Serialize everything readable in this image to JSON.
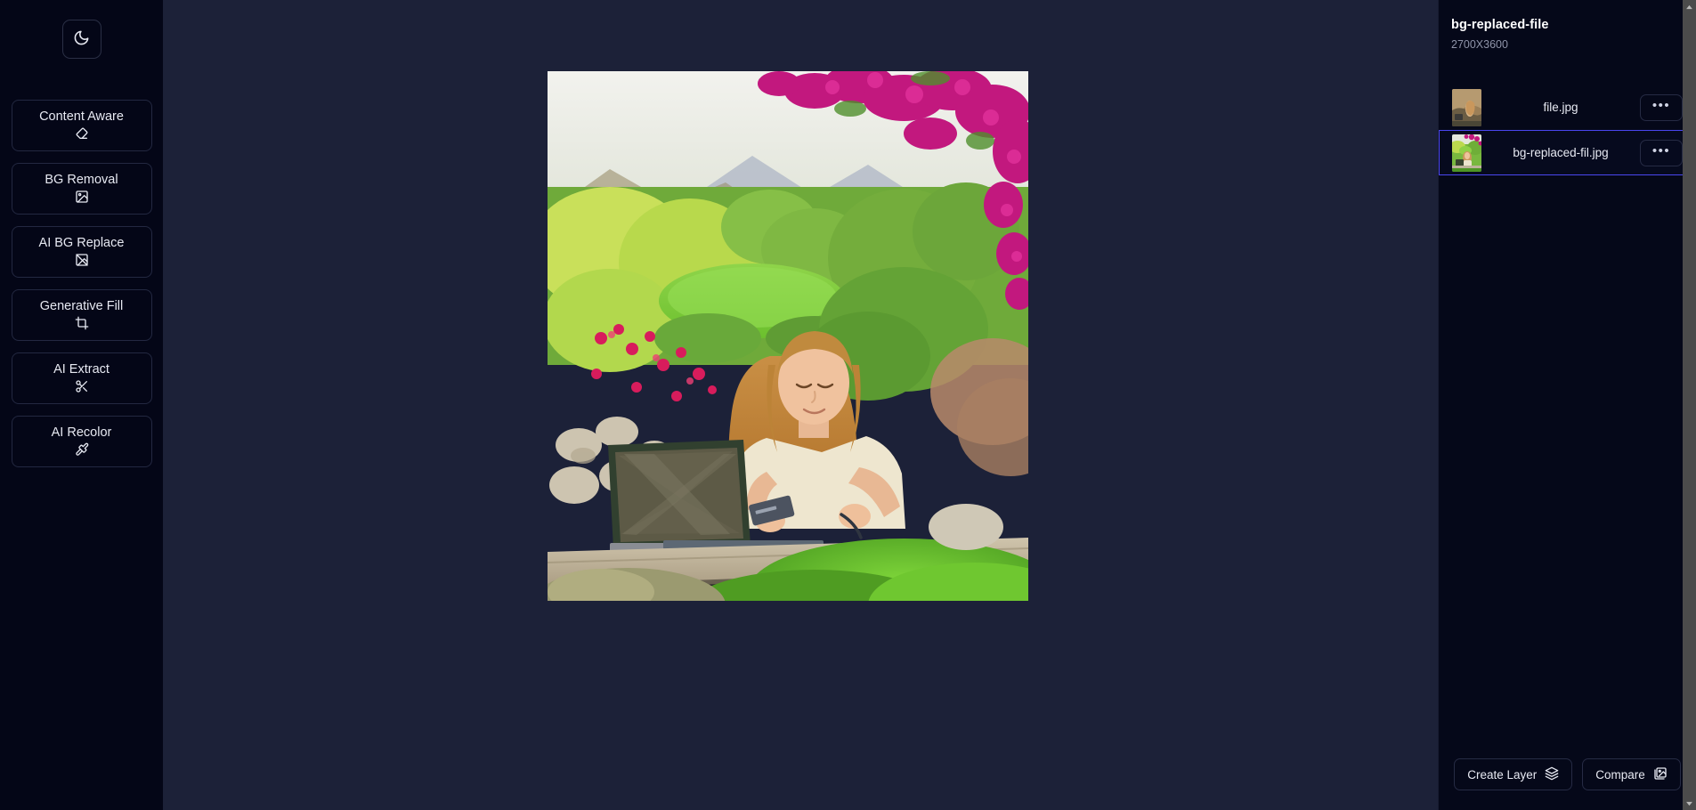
{
  "theme_toggle": {
    "icon": "moon-icon",
    "label": "Toggle dark mode"
  },
  "sidebar": {
    "tools": [
      {
        "label": "Content Aware",
        "icon": "eraser-icon"
      },
      {
        "label": "BG Removal",
        "icon": "image-icon"
      },
      {
        "label": "AI BG Replace",
        "icon": "image-off-icon"
      },
      {
        "label": "Generative Fill",
        "icon": "crop-icon"
      },
      {
        "label": "AI Extract",
        "icon": "scissors-icon"
      },
      {
        "label": "AI Recolor",
        "icon": "paintbrush-icon"
      }
    ]
  },
  "canvas": {
    "image_alt": "Woman working on a laptop on a stone bench in a flowering garden"
  },
  "right_panel": {
    "title": "bg-replaced-file",
    "dimensions": "2700X3600",
    "files": [
      {
        "name": "file.jpg",
        "menu_label": "•••",
        "selected": false,
        "thumb": "original-rocky-thumb"
      },
      {
        "name": "bg-replaced-fil.jpg",
        "menu_label": "•••",
        "selected": true,
        "thumb": "garden-replaced-thumb"
      }
    ],
    "footer": {
      "create_layer": {
        "label": "Create Layer",
        "icon": "layers-icon"
      },
      "compare": {
        "label": "Compare",
        "icon": "compare-image-icon"
      }
    }
  },
  "colors": {
    "sidebar_bg": "#040617",
    "canvas_bg": "#1c2138",
    "panel_bg": "#050819",
    "accent_selected": "#4a46f0",
    "text_primary": "#e7e9f2",
    "text_muted": "#8e93a8",
    "scrollbar": "#4b4b4b"
  }
}
